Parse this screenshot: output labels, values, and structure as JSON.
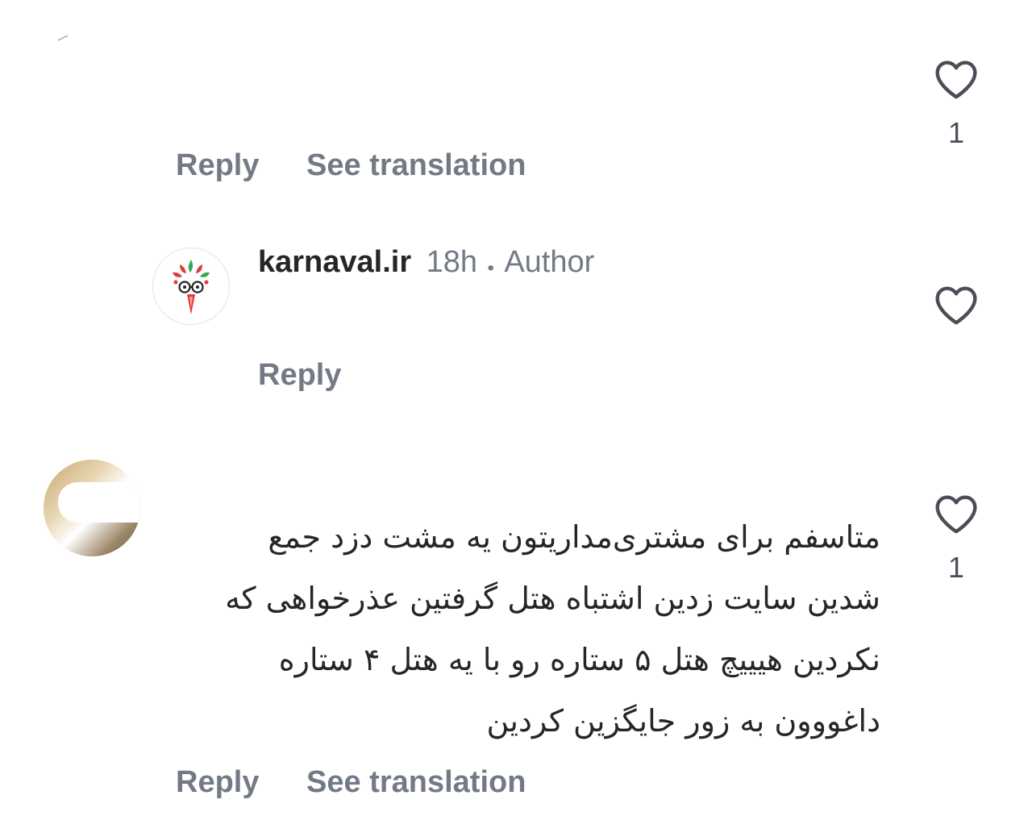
{
  "thread": {
    "top_comment": {
      "likes": "1",
      "actions": {
        "reply": "Reply",
        "translate": "See translation"
      }
    },
    "author_reply": {
      "username": "karnaval.ir",
      "time": "18h",
      "separator": "•",
      "badge": "Author",
      "reply": "Reply"
    },
    "comment": {
      "likes": "1",
      "lines": [
        "متاسفم برای مشتری‌مداریتون یه مشت دزد جمع",
        "شدین سایت زدین اشتباه هتل گرفتین عذرخواهی که",
        "نکردین هیییچ هتل ۵ ستاره رو با یه هتل ۴ ستاره",
        "داغووون به زور جایگزین کردین"
      ],
      "actions": {
        "reply": "Reply",
        "translate": "See translation"
      }
    }
  },
  "colors": {
    "text": "#262626",
    "secondary": "#737a86",
    "icon": "#4a4f57",
    "brand_red": "#e1393b",
    "brand_green": "#3aa655"
  }
}
